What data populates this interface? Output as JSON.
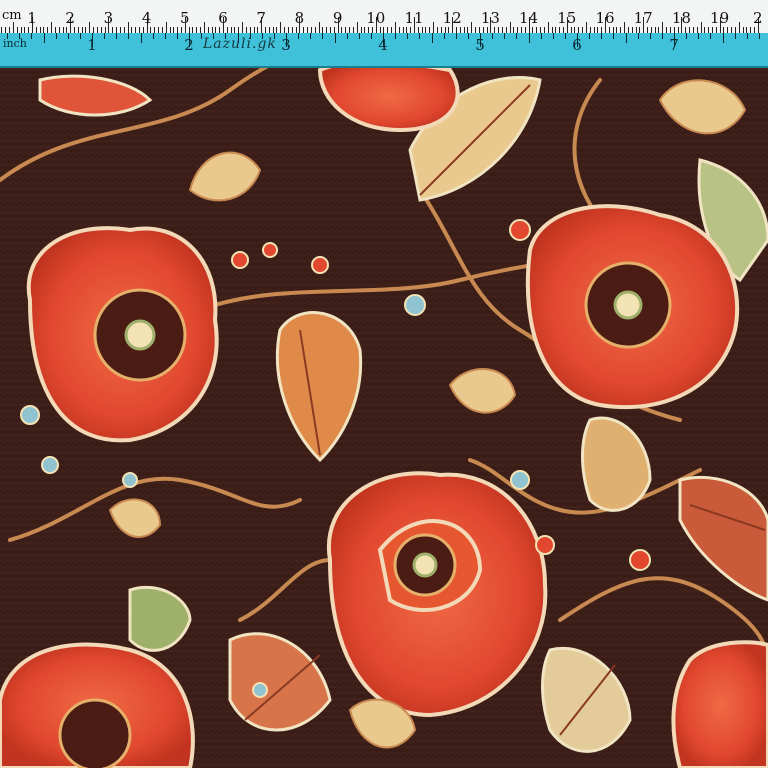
{
  "ruler": {
    "cm_unit": "cm",
    "inch_unit": "inch",
    "cm_labels": [
      "1",
      "2",
      "3",
      "4",
      "5",
      "6",
      "7",
      "8",
      "9",
      "10",
      "11",
      "12",
      "13",
      "14",
      "15",
      "16",
      "17",
      "18",
      "19",
      "2"
    ],
    "inch_labels": [
      "1",
      "2",
      "3",
      "4",
      "5",
      "6",
      "7"
    ],
    "handwritten_mark": "Lazuli.gk"
  },
  "colors": {
    "background": "#3a1d17",
    "poppy": "#e1482f",
    "poppy_dark": "#b8321f",
    "leaf_cream": "#e9c98e",
    "stem": "#c98a52",
    "accent_blue": "#8fc3d0",
    "ruler_cyan": "#3fc1d9"
  }
}
